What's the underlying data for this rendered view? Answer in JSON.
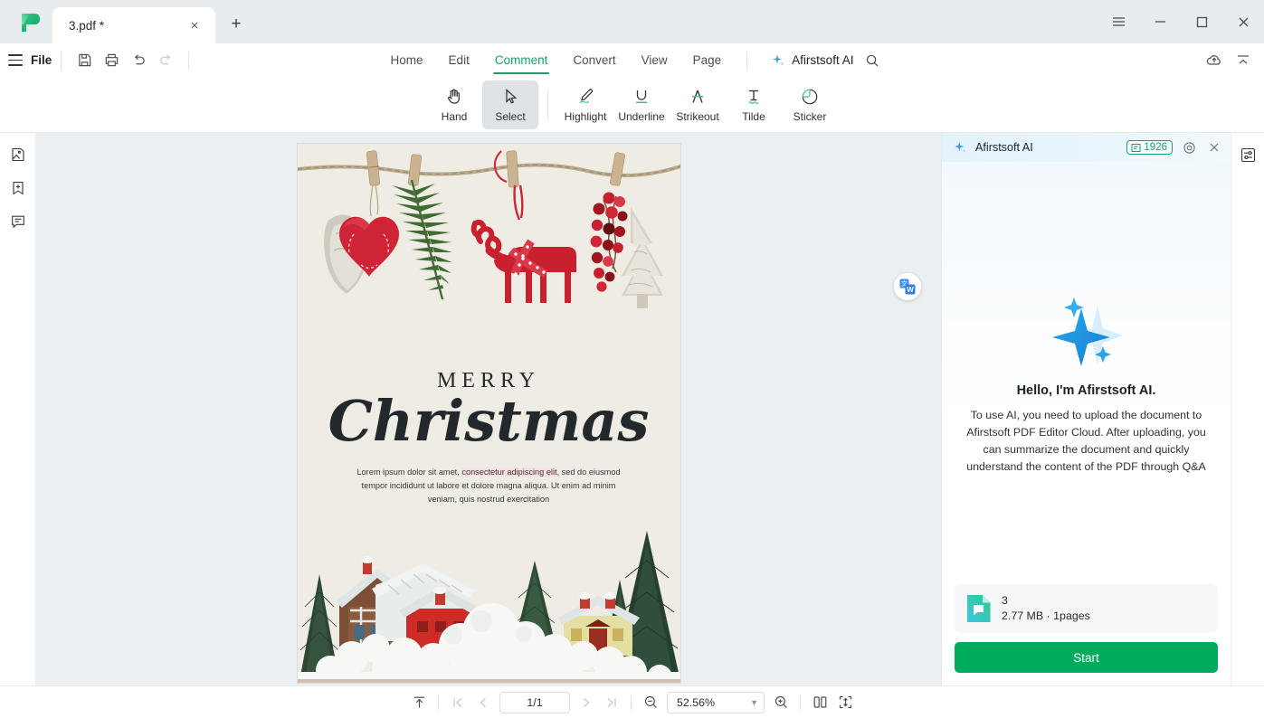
{
  "window": {
    "tab_title": "3.pdf *",
    "new_tab_label": "+",
    "close_label": "×",
    "menu_icon": "hamburger-icon",
    "minimize_label": "—",
    "maximize_label": "□",
    "window_close_label": "×"
  },
  "menubar": {
    "file_label": "File",
    "quick_actions": [
      {
        "name": "save-as-icon",
        "label": "Save"
      },
      {
        "name": "print-icon",
        "label": "Print"
      },
      {
        "name": "undo-icon",
        "label": "Undo"
      },
      {
        "name": "redo-icon",
        "label": "Redo"
      }
    ],
    "tabs": [
      {
        "label": "Home",
        "active": false
      },
      {
        "label": "Edit",
        "active": false
      },
      {
        "label": "Comment",
        "active": true
      },
      {
        "label": "Convert",
        "active": false
      },
      {
        "label": "View",
        "active": false
      },
      {
        "label": "Page",
        "active": false
      }
    ],
    "ai_entry_label": "Afirstsoft AI",
    "search_icon": "search-icon",
    "cloud_icon": "cloud-upload-icon",
    "collapse_icon": "collapse-ribbon-icon"
  },
  "ribbon": {
    "tools": [
      {
        "label": "Hand",
        "icon": "hand-icon",
        "selected": false
      },
      {
        "label": "Select",
        "icon": "cursor-select-icon",
        "selected": true
      },
      {
        "label": "Highlight",
        "icon": "highlight-pen-icon",
        "selected": false
      },
      {
        "label": "Underline",
        "icon": "underline-icon",
        "selected": false
      },
      {
        "label": "Strikeout",
        "icon": "strikeout-icon",
        "selected": false
      },
      {
        "label": "Tilde",
        "icon": "tilde-squiggly-icon",
        "selected": false
      },
      {
        "label": "Sticker",
        "icon": "sticker-note-icon",
        "selected": false
      }
    ]
  },
  "left_rail": {
    "items": [
      {
        "name": "thumbnails-icon"
      },
      {
        "name": "bookmark-add-icon"
      },
      {
        "name": "comments-icon"
      }
    ]
  },
  "right_rail": {
    "items": [
      {
        "name": "properties-panel-icon"
      }
    ]
  },
  "document": {
    "translate_button": "translate-to-word-icon",
    "heading_small": "MERRY",
    "heading_large": "Christmas",
    "body_lead": "Lorem ipsum dolor sit amet, ",
    "body_highlight": "consectetur adipiscing elit",
    "body_rest": ", sed do eiusmod tempor incididunt ut labore et dolore magna aliqua. Ut enim ad minim veniam, quis nostrud exercitation",
    "highlight_color": "#fbe0e2",
    "page_background": "#eeece3"
  },
  "ai_panel": {
    "title": "Afirstsoft AI",
    "credits": "1926",
    "credits_icon": "credit-token-icon",
    "settings_icon": "target-settings-icon",
    "close_icon": "close-icon",
    "sparkle_icon": "ai-sparkle-icon",
    "greeting": "Hello, I'm Afirstsoft AI.",
    "description": "To use AI, you need to upload the document to Afirstsoft PDF Editor Cloud. After uploading, you can summarize the document and quickly understand the content of the PDF through Q&A",
    "file": {
      "icon": "pdf-file-icon",
      "name": "3",
      "details": "2.77 MB · 1pages"
    },
    "start_button": "Start",
    "accent_color": "#00ab5c",
    "header_accent": "#18a06b"
  },
  "statusbar": {
    "fit_top_icon": "scroll-to-top-icon",
    "first_page_icon": "first-page-icon",
    "prev_page_icon": "prev-page-icon",
    "page_indicator": "1/1",
    "next_page_icon": "next-page-icon",
    "last_page_icon": "last-page-icon",
    "zoom_out_icon": "zoom-out-icon",
    "zoom_value": "52.56%",
    "zoom_in_icon": "zoom-in-icon",
    "dual_page_icon": "dual-page-view-icon",
    "fit_page_icon": "fit-page-icon"
  }
}
